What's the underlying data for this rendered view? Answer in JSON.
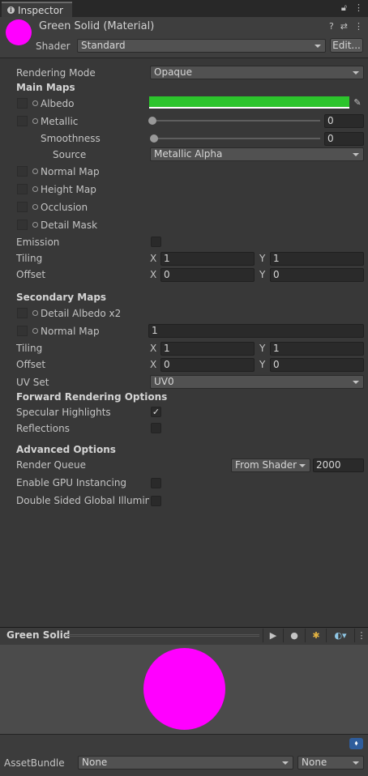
{
  "tab": {
    "label": "Inspector"
  },
  "header": {
    "title": "Green Solid (Material)",
    "shader_label": "Shader",
    "shader_value": "Standard",
    "edit_label": "Edit..."
  },
  "props": {
    "rendering_mode_label": "Rendering Mode",
    "rendering_mode_value": "Opaque",
    "main_maps": "Main Maps",
    "albedo": "Albedo",
    "albedo_color": "#2cc42c",
    "metallic": "Metallic",
    "metallic_value": "0",
    "smoothness": "Smoothness",
    "smoothness_value": "0",
    "source": "Source",
    "source_value": "Metallic Alpha",
    "normal_map": "Normal Map",
    "height_map": "Height Map",
    "occlusion": "Occlusion",
    "detail_mask": "Detail Mask",
    "emission": "Emission",
    "tiling": "Tiling",
    "offset": "Offset",
    "x": "X",
    "y": "Y",
    "tiling_x": "1",
    "tiling_y": "1",
    "offset_x": "0",
    "offset_y": "0",
    "secondary_maps": "Secondary Maps",
    "detail_albedo": "Detail Albedo x2",
    "normal_map2": "Normal Map",
    "normal_map2_value": "1",
    "tiling2_x": "1",
    "tiling2_y": "1",
    "offset2_x": "0",
    "offset2_y": "0",
    "uv_set": "UV Set",
    "uv_set_value": "UV0",
    "forward": "Forward Rendering Options",
    "specular": "Specular Highlights",
    "specular_checked": true,
    "reflections": "Reflections",
    "reflections_checked": false,
    "advanced": "Advanced Options",
    "render_queue": "Render Queue",
    "render_queue_mode": "From Shader",
    "render_queue_value": "2000",
    "gpu_instancing": "Enable GPU Instancing",
    "double_sided": "Double Sided Global Illuminat"
  },
  "preview": {
    "title": "Green Solid",
    "color": "#ff00ff"
  },
  "asset_bundle": {
    "label": "AssetBundle",
    "name_value": "None",
    "variant_value": "None"
  }
}
